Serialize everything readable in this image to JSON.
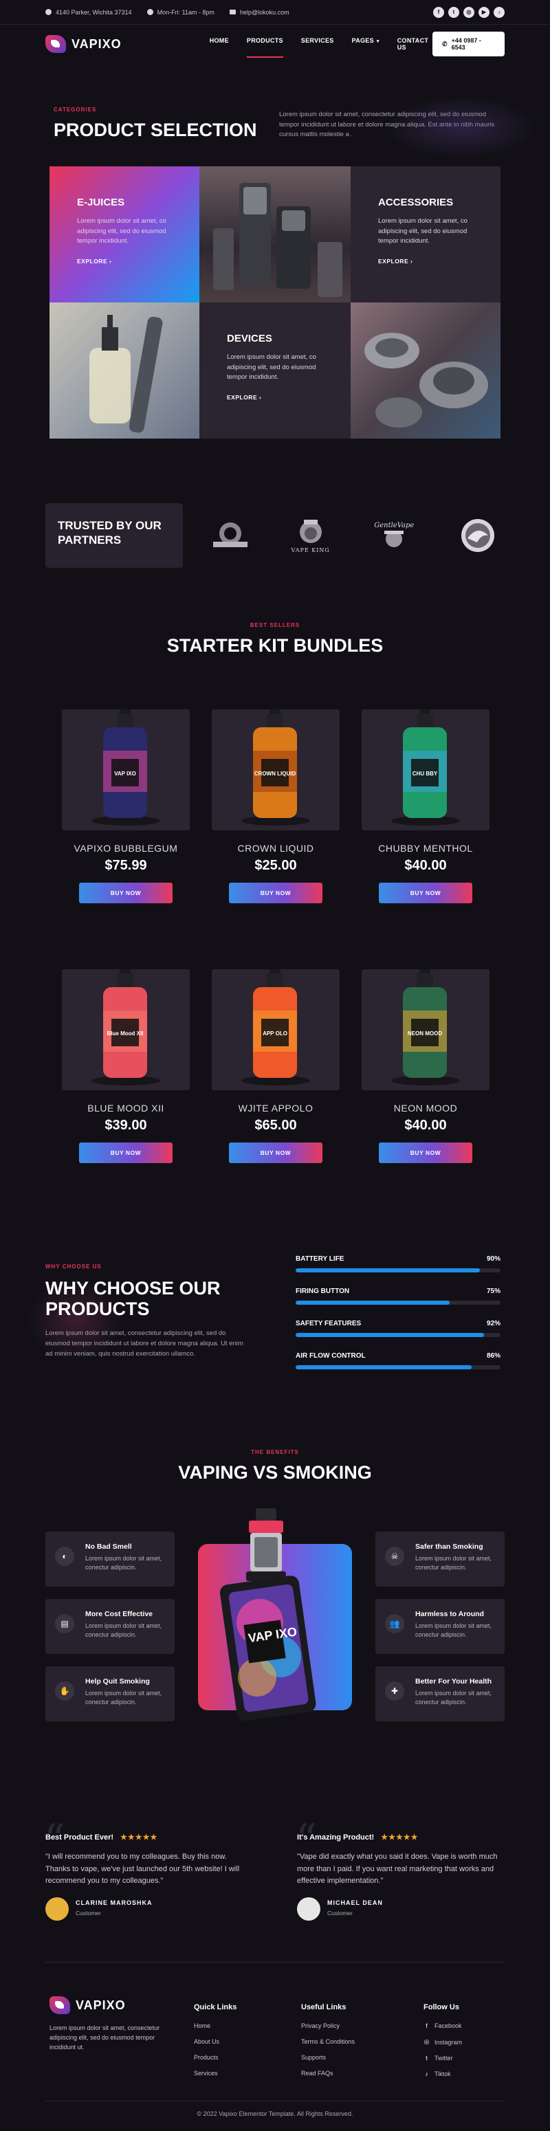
{
  "topbar": {
    "address": "4140 Parker, Wichita 37314",
    "hours": "Mon-Fri: 11am - 8pm",
    "email": "help@lokoku.com",
    "socials": [
      {
        "icon": "facebook-icon",
        "glyph": "f"
      },
      {
        "icon": "twitter-icon",
        "glyph": "t"
      },
      {
        "icon": "instagram-icon",
        "glyph": "◎"
      },
      {
        "icon": "youtube-icon",
        "glyph": "▶"
      },
      {
        "icon": "tiktok-icon",
        "glyph": "♪"
      }
    ]
  },
  "nav": {
    "brand": "VAPIXO",
    "items": [
      "HOME",
      "PRODUCTS",
      "SERVICES",
      "PAGES",
      "CONTACT US"
    ],
    "active_index": 1,
    "phone": "+44 0987 - 6543"
  },
  "selection": {
    "eyebrow": "CATEGORIES",
    "title": "PRODUCT SELECTION",
    "text": "Lorem ipsum dolor sit amet, consectetur adipiscing elit, sed do eiusmod tempor incididunt ut labore et dolore magna aliqua. Est ante in nibh mauris cursus mattis molestie a .",
    "tiles": [
      {
        "title": "E-JUICES",
        "text": "Lorem ipsum dolor sit amet, co adipiscing elit, sed do eiusmod tempor incididunt.",
        "cta": "EXPLORE"
      },
      {
        "title": "ACCESSORIES",
        "text": "Lorem ipsum dolor sit amet, co adipiscing elit, sed do eiusmod tempor incididunt.",
        "cta": "EXPLORE"
      },
      {
        "title": "DEVICES",
        "text": "Lorem ipsum dolor sit amet, co adipiscing elit, sed do eiusmod tempor incididunt.",
        "cta": "EXPLORE"
      }
    ]
  },
  "partners": {
    "title": "TRUSTED BY OUR PARTNERS",
    "logos": [
      "",
      "VAPE KING",
      "GentleVape",
      ""
    ]
  },
  "bundles": {
    "eyebrow": "BEST SELLERS",
    "title": "STARTER KIT BUNDLES",
    "cta": "BUY NOW",
    "products": [
      {
        "name": "VAPIXO BUBBLEGUM",
        "price": "$75.99",
        "label": "VAP IXO",
        "body": "#2b2a6a",
        "accent": "#e04590"
      },
      {
        "name": "CROWN LIQUID",
        "price": "$25.00",
        "label": "CROWN LIQUID",
        "body": "#d9791a",
        "accent": "#9a3c10"
      },
      {
        "name": "CHUBBY MENTHOL",
        "price": "$40.00",
        "label": "CHU BBY",
        "body": "#1f9c6a",
        "accent": "#3aa4d8"
      },
      {
        "name": "BLUE MOOD XII",
        "price": "$39.00",
        "label": "Blue Mood XII",
        "body": "#e8505e",
        "accent": "#f07a6a"
      },
      {
        "name": "WJITE APPOLO",
        "price": "$65.00",
        "label": "APP OLO",
        "body": "#ef5a2a",
        "accent": "#f4a02a"
      },
      {
        "name": "NEON MOOD",
        "price": "$40.00",
        "label": "NEON MOOD",
        "body": "#2c6a4a",
        "accent": "#e8a030"
      }
    ]
  },
  "why": {
    "eyebrow": "WHY CHOOSE US",
    "title": "WHY CHOOSE OUR PRODUCTS",
    "text": "Lorem ipsum dolor sit amet, consectetur adipiscing elit, sed do eiusmod tempor incididunt ut labore et dolore magna aliqua. Ut enim ad minim veniam, quis nostrud exercitation ullamco.",
    "stats": [
      {
        "label": "BATTERY LIFE",
        "value": "90%",
        "pct": 90
      },
      {
        "label": "FIRING BUTTON",
        "value": "75%",
        "pct": 75
      },
      {
        "label": "SAFETY FEATURES",
        "value": "92%",
        "pct": 92
      },
      {
        "label": "AIR FLOW CONTROL",
        "value": "86%",
        "pct": 86
      }
    ]
  },
  "benefits": {
    "eyebrow": "THE BENEFITS",
    "title": "VAPING VS SMOKING",
    "device_label": "VAP IXO",
    "left": [
      {
        "title": "No Bad Smell",
        "text": "Lorem ipsum dolor sit amet, conectur adipiscin.",
        "icon": "smell-icon",
        "glyph": "◐"
      },
      {
        "title": "More Cost Effective",
        "text": "Lorem ipsum dolor sit amet, conectur adipiscin.",
        "icon": "wallet-icon",
        "glyph": "▤"
      },
      {
        "title": "Help Quit Smoking",
        "text": "Lorem ipsum dolor sit amet, conectur adipiscin.",
        "icon": "no-smoking-icon",
        "glyph": "✋"
      }
    ],
    "right": [
      {
        "title": "Safer than Smoking",
        "text": "Lorem ipsum dolor sit amet, conectur adipiscin.",
        "icon": "skull-icon",
        "glyph": "☠"
      },
      {
        "title": "Harmless to Around",
        "text": "Lorem ipsum dolor sit amet, conectur adipiscin.",
        "icon": "people-icon",
        "glyph": "👥"
      },
      {
        "title": "Better For Your Health",
        "text": "Lorem ipsum dolor sit amet, conectur adipiscin.",
        "icon": "health-icon",
        "glyph": "✚"
      }
    ]
  },
  "testimonials": [
    {
      "title": "Best Product Ever!",
      "stars": "★★★★★",
      "quote": "\"I will recommend you to my colleagues. Buy this now. Thanks to vape, we've just launched our 5th website! I will recommend you to my colleagues.\"",
      "name": "CLARINE MAROSHKA",
      "role": "Customer",
      "avatar_color": "#e8b23a"
    },
    {
      "title": "It's Amazing Product!",
      "stars": "★★★★★",
      "quote": "\"Vape did exactly what you said it does. Vape is worth much more than I paid. If you want real marketing that works and effective implementation.\"",
      "name": "MICHAEL DEAN",
      "role": "Customer",
      "avatar_color": "#e6e6e6"
    }
  ],
  "footer": {
    "brand": "VAPIXO",
    "about": "Lorem ipsum dolor sit amet, consectetur adipiscing elit, sed do eiusmod tempor incididunt ut.",
    "quick_title": "Quick Links",
    "quick": [
      "Home",
      "About Us",
      "Products",
      "Services"
    ],
    "useful_title": "Useful Links",
    "useful": [
      "Privacy Policy",
      "Terms & Conditions",
      "Supports",
      "Read FAQs"
    ],
    "follow_title": "Follow Us",
    "follow": [
      {
        "label": "Facebook",
        "icon": "facebook-icon",
        "glyph": "f"
      },
      {
        "label": "Instagram",
        "icon": "instagram-icon",
        "glyph": "◎"
      },
      {
        "label": "Twitter",
        "icon": "twitter-icon",
        "glyph": "t"
      },
      {
        "label": "Tiktok",
        "icon": "tiktok-icon",
        "glyph": "♪"
      }
    ],
    "copyright": "© 2022 Vapixo Elementor Template. All Rights Reserved."
  },
  "colors": {
    "accent": "#e8355a",
    "blue": "#1e8fe8",
    "bg": "#121016",
    "card": "#2a2530"
  }
}
